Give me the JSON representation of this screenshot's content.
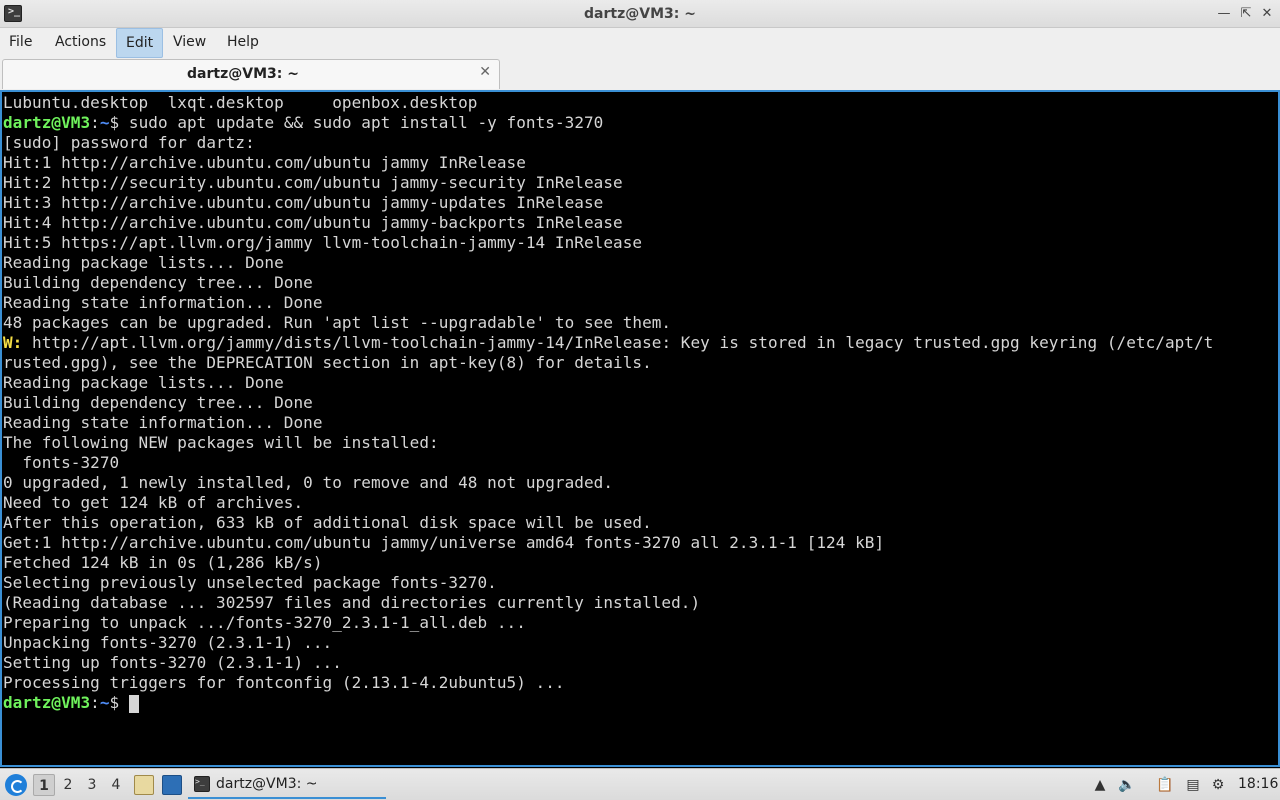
{
  "window": {
    "title": "dartz@VM3: ~"
  },
  "menu": {
    "items": [
      {
        "label": "File"
      },
      {
        "label": "Actions"
      },
      {
        "label": "Edit"
      },
      {
        "label": "View"
      },
      {
        "label": "Help"
      }
    ],
    "active": "Edit"
  },
  "tab": {
    "label": "dartz@VM3: ~",
    "close_glyph": "✕"
  },
  "terminal": {
    "colors": {
      "prompt_user": "#6ff25c",
      "prompt_path": "#4f8df7",
      "warning": "#f7e046",
      "text": "#d6d6d6"
    },
    "prompt": {
      "user": "dartz@VM3",
      "sep": ":",
      "path": "~",
      "symbol": "$ "
    },
    "lines": [
      {
        "t": "Lubuntu.desktop  lxqt.desktop     openbox.desktop"
      },
      {
        "prompt": true,
        "t": "sudo apt update && sudo apt install -y fonts-3270"
      },
      {
        "t": "[sudo] password for dartz:"
      },
      {
        "t": "Hit:1 http://archive.ubuntu.com/ubuntu jammy InRelease"
      },
      {
        "t": "Hit:2 http://security.ubuntu.com/ubuntu jammy-security InRelease"
      },
      {
        "t": "Hit:3 http://archive.ubuntu.com/ubuntu jammy-updates InRelease"
      },
      {
        "t": "Hit:4 http://archive.ubuntu.com/ubuntu jammy-backports InRelease"
      },
      {
        "t": "Hit:5 https://apt.llvm.org/jammy llvm-toolchain-jammy-14 InRelease"
      },
      {
        "t": "Reading package lists... Done"
      },
      {
        "t": "Building dependency tree... Done"
      },
      {
        "t": "Reading state information... Done"
      },
      {
        "t": "48 packages can be upgraded. Run 'apt list --upgradable' to see them."
      },
      {
        "warn": "W:",
        "t": " http://apt.llvm.org/jammy/dists/llvm-toolchain-jammy-14/InRelease: Key is stored in legacy trusted.gpg keyring (/etc/apt/t"
      },
      {
        "t": "rusted.gpg), see the DEPRECATION section in apt-key(8) for details."
      },
      {
        "t": "Reading package lists... Done"
      },
      {
        "t": "Building dependency tree... Done"
      },
      {
        "t": "Reading state information... Done"
      },
      {
        "t": "The following NEW packages will be installed:"
      },
      {
        "t": "  fonts-3270"
      },
      {
        "t": "0 upgraded, 1 newly installed, 0 to remove and 48 not upgraded."
      },
      {
        "t": "Need to get 124 kB of archives."
      },
      {
        "t": "After this operation, 633 kB of additional disk space will be used."
      },
      {
        "t": "Get:1 http://archive.ubuntu.com/ubuntu jammy/universe amd64 fonts-3270 all 2.3.1-1 [124 kB]"
      },
      {
        "t": "Fetched 124 kB in 0s (1,286 kB/s)"
      },
      {
        "t": "Selecting previously unselected package fonts-3270."
      },
      {
        "t": "(Reading database ... 302597 files and directories currently installed.)"
      },
      {
        "t": "Preparing to unpack .../fonts-3270_2.3.1-1_all.deb ..."
      },
      {
        "t": "Unpacking fonts-3270 (2.3.1-1) ..."
      },
      {
        "t": "Setting up fonts-3270 (2.3.1-1) ..."
      },
      {
        "t": "Processing triggers for fontconfig (2.13.1-4.2ubuntu5) ..."
      },
      {
        "prompt": true,
        "t": "",
        "cursor": true
      }
    ]
  },
  "taskbar": {
    "workspaces": [
      "1",
      "2",
      "3",
      "4"
    ],
    "active_workspace": "1",
    "task_label": "dartz@VM3: ~",
    "clock": "18:16",
    "tray_icons": [
      "scroll-up-icon",
      "volume-icon",
      "clipboard-icon",
      "network-icon",
      "update-notifier-icon"
    ]
  }
}
